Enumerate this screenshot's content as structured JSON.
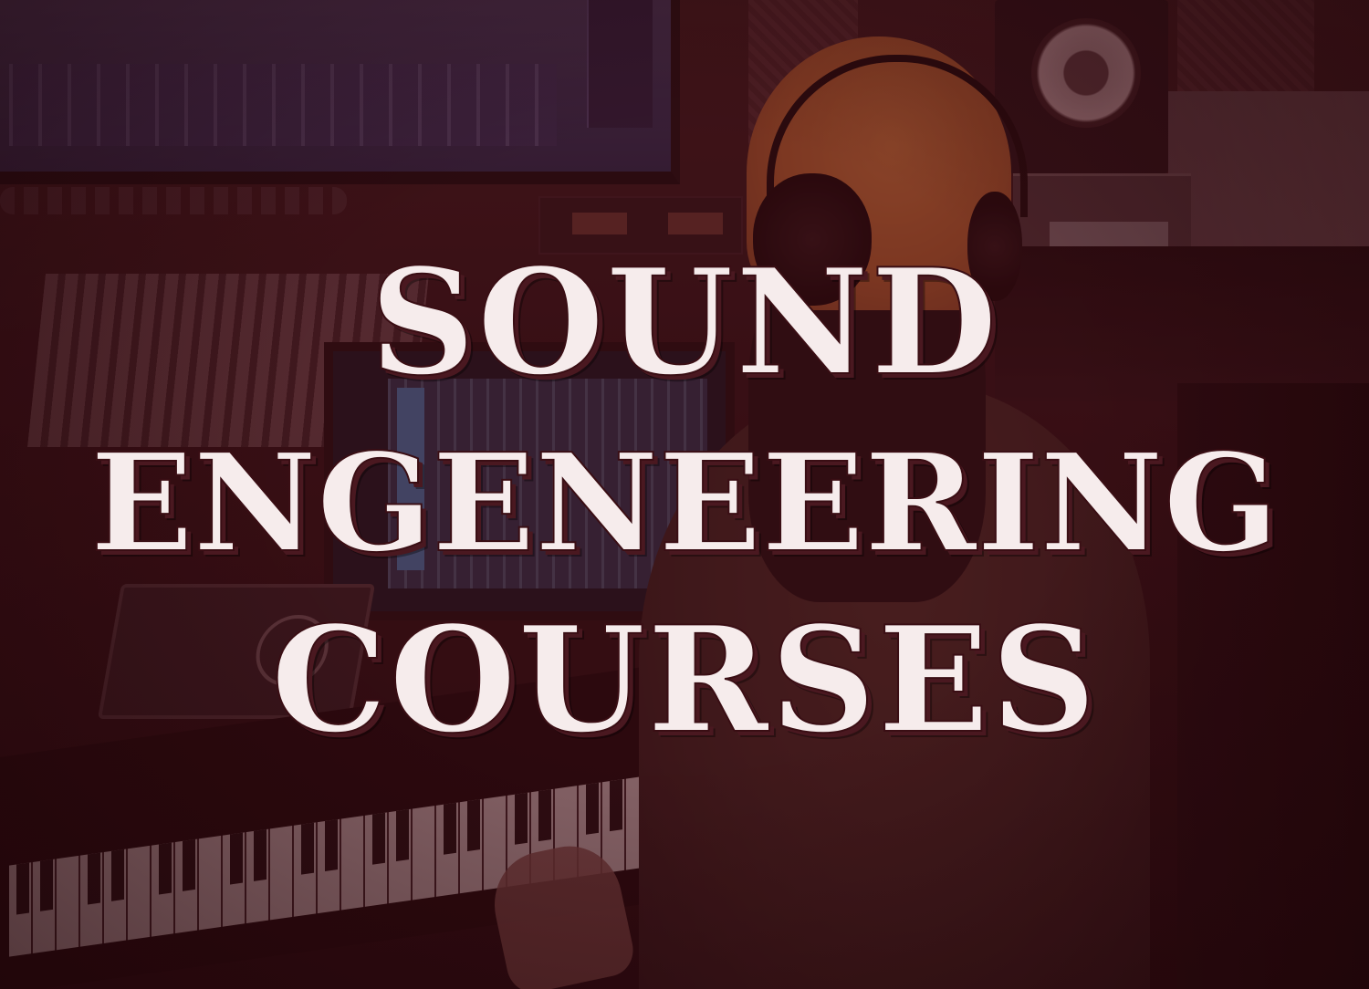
{
  "headline": {
    "lines": [
      "SOUND",
      "ENGENEERING",
      "COURSES"
    ]
  },
  "colors": {
    "overlay_tint": "#460e16",
    "headline_text": "#f6ecec",
    "headline_shadow": "#4a1820"
  },
  "background_photo": {
    "subject_icon": "music-studio-photo"
  }
}
